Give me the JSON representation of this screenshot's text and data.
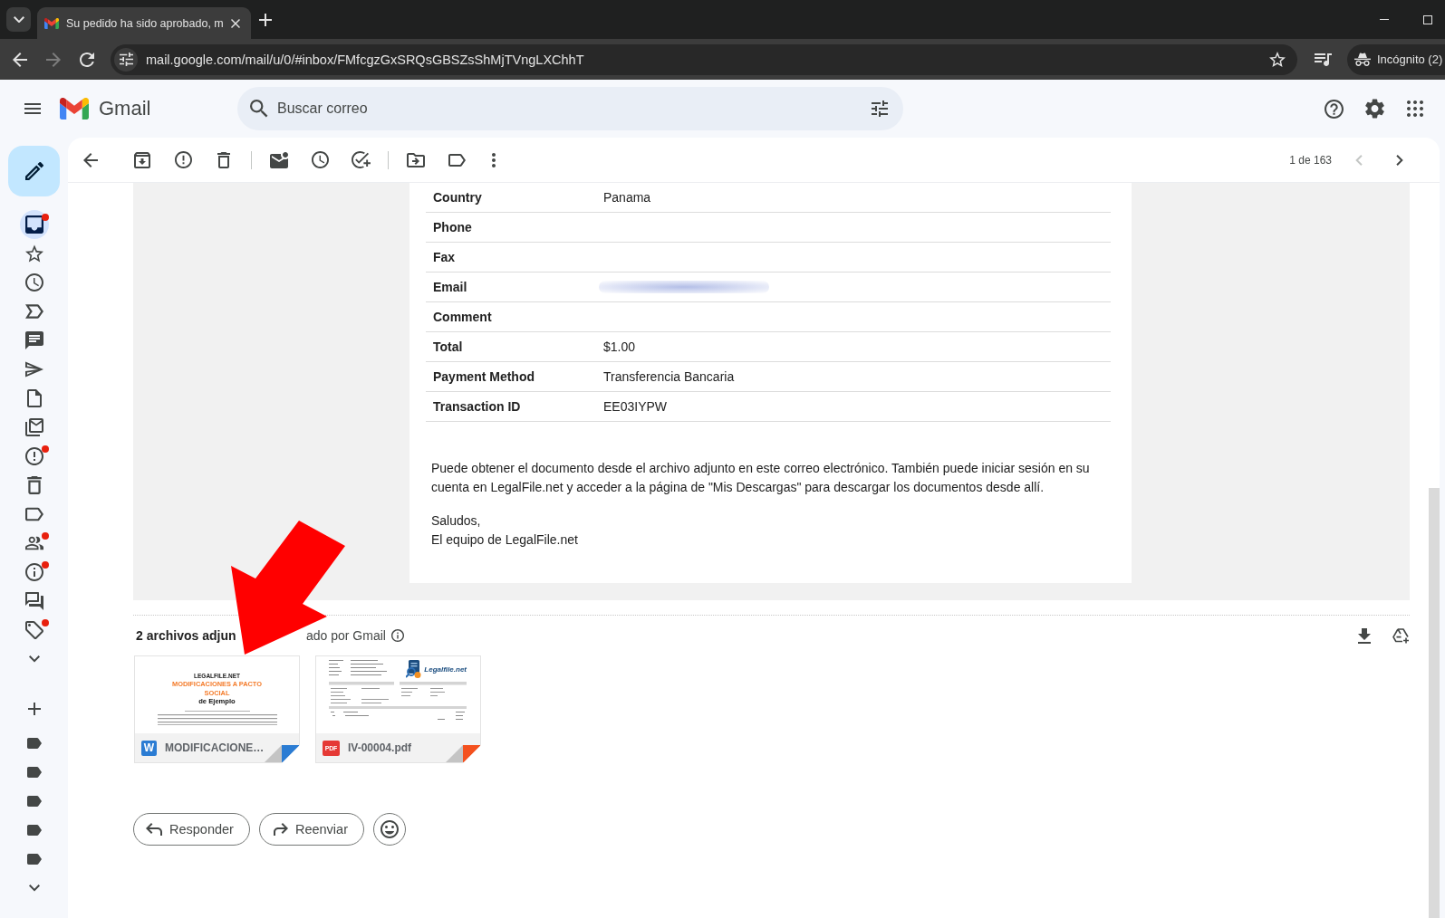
{
  "browser": {
    "tab": {
      "title": "Su pedido ha sido aprobado, m",
      "selected": true
    },
    "nav_buttons": [
      {
        "disabled": false
      },
      {
        "disabled": true
      },
      {
        "disabled": false
      }
    ],
    "address": {
      "url": "mail.google.com/mail/u/0/#inbox/FMfcgzGxSRQsGBSZsShMjTVngLXChhT"
    },
    "profile": {
      "label": "Incógnito (2)"
    }
  },
  "gmail": {
    "app_name": "Gmail",
    "search": {
      "placeholder": "Buscar correo"
    },
    "rail": {
      "items": [
        {
          "selected": true,
          "notified": true
        },
        {
          "selected": false,
          "notified": false
        },
        {
          "selected": false,
          "notified": false
        },
        {
          "selected": false,
          "notified": false
        },
        {
          "selected": false,
          "notified": false
        },
        {
          "selected": false,
          "notified": false
        },
        {
          "selected": false,
          "notified": false
        },
        {
          "selected": false,
          "notified": false
        },
        {
          "selected": false,
          "notified": true
        },
        {
          "selected": false,
          "notified": false
        },
        {
          "selected": false,
          "notified": false
        },
        {
          "selected": false,
          "notified": true
        },
        {
          "selected": false,
          "notified": true
        },
        {
          "selected": false,
          "notified": false
        },
        {
          "selected": false,
          "notified": true
        }
      ]
    },
    "toolbar": {
      "pager": {
        "label": "1 de 163",
        "buttons": [
          {
            "disabled": true
          },
          {
            "disabled": false
          }
        ]
      }
    },
    "message": {
      "rows": [
        {
          "label": "Country",
          "value": "Panama",
          "redacted": false
        },
        {
          "label": "Phone",
          "redacted": false
        },
        {
          "label": "Fax",
          "redacted": false
        },
        {
          "label": "Email",
          "redacted": true
        },
        {
          "label": "Comment",
          "redacted": false
        },
        {
          "label": "Total",
          "value": "$1.00",
          "redacted": false
        },
        {
          "label": "Payment Method",
          "value": "Transferencia Bancaria",
          "redacted": false
        },
        {
          "label": "Transaction ID",
          "value": "EE03IYPW",
          "redacted": false
        }
      ],
      "paragraph": "Puede obtener el documento desde el archivo adjunto en este correo electrónico. También puede iniciar sesión en su cuenta en LegalFile.net y acceder a la página de \"Mis Descargas\" para descargar los documentos desde allí.",
      "closing": [
        "Saludos,",
        "El equipo de LegalFile.net"
      ]
    },
    "attachments": {
      "summary": [
        "2 archivos adjun",
        "ado por Gmail"
      ],
      "files": [
        {
          "kind": "word",
          "badge": "W",
          "name": "MODIFICACIONE…",
          "preview": {
            "brand": "LEGALFILE.NET",
            "title": "MODIFICACIONES A PACTO SOCIAL",
            "subtitle": "de Ejemplo"
          }
        },
        {
          "kind": "pdf",
          "badge": "PDF",
          "name": "IV-00004.pdf",
          "preview": {
            "logo": "Legalfile.net"
          }
        }
      ]
    },
    "actions": [
      {
        "kind": "reply",
        "label": "Responder"
      },
      {
        "kind": "forward",
        "label": "Reenviar"
      },
      {
        "kind": "emoji"
      }
    ]
  },
  "annotations": [
    {
      "kind": "arrow"
    }
  ]
}
